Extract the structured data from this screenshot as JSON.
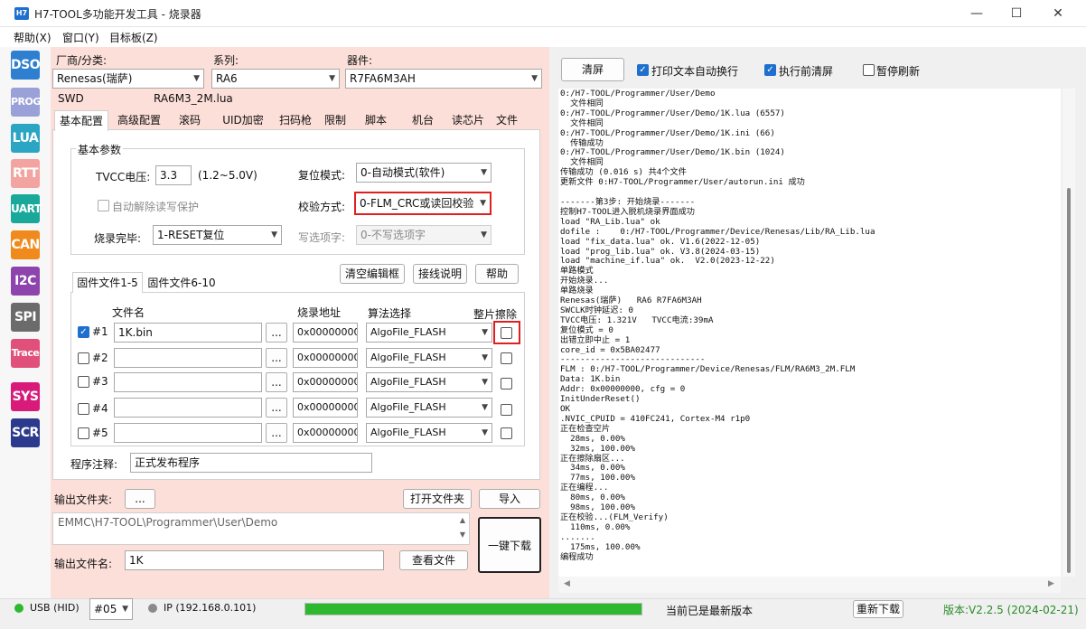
{
  "window": {
    "title": "H7-TOOL多功能开发工具 - 烧录器",
    "icon_text": "H7",
    "minimize": "—",
    "maximize": "☐",
    "close": "✕"
  },
  "menu": [
    "帮助(X)",
    "窗口(Y)",
    "目标板(Z)"
  ],
  "sidebar": [
    {
      "label": "DSO",
      "color": "#2f7fd0"
    },
    {
      "label": "PROG",
      "color": "#9aa0d8"
    },
    {
      "label": "LUA",
      "color": "#2aa6c4"
    },
    {
      "label": "RTT",
      "color": "#f2a4a0"
    },
    {
      "label": "UART",
      "color": "#1aa89a"
    },
    {
      "label": "CAN",
      "color": "#f08a1c"
    },
    {
      "label": "I2C",
      "color": "#8e44ad"
    },
    {
      "label": "SPI",
      "color": "#6b6b6b"
    },
    {
      "label": "Trace",
      "color": "#e0507a"
    },
    {
      "label": "SYS",
      "color": "#d81b7a"
    },
    {
      "label": "SCR",
      "color": "#2b3a8c"
    }
  ],
  "vendor": {
    "label": "厂商/分类:",
    "value": "Renesas(瑞萨)"
  },
  "series": {
    "label": "系列:",
    "value": "RA6"
  },
  "device": {
    "label": "器件:",
    "value": "R7FA6M3AH"
  },
  "interface": "SWD",
  "lua_file": "RA6M3_2M.lua",
  "tabs": [
    "基本配置",
    "高级配置",
    "滚码",
    "UID加密",
    "扫码枪",
    "限制",
    "脚本",
    "机台",
    "读芯片",
    "文件"
  ],
  "basic": {
    "group_title": "基本参数",
    "tvcc_label": "TVCC电压:",
    "tvcc_value": "3.3",
    "tvcc_range": "(1.2~5.0V)",
    "reset_label": "复位模式:",
    "reset_value": "0-自动模式(软件)",
    "auto_unlock_label": "自动解除读写保护",
    "verify_label": "校验方式:",
    "verify_value": "0-FLM_CRC或读回校验",
    "after_label": "烧录完毕:",
    "after_value": "1-RESET复位",
    "option_label": "写选项字:",
    "option_value": "0-不写选项字"
  },
  "actions": {
    "clear": "清空编辑框",
    "wiring": "接线说明",
    "help": "帮助"
  },
  "file_tabs": [
    "固件文件1-5",
    "固件文件6-10"
  ],
  "file_table": {
    "headers": {
      "filename": "文件名",
      "address": "烧录地址",
      "algo": "算法选择",
      "erase": "整片擦除"
    },
    "browse_label": "...",
    "rows": [
      {
        "id": "#1",
        "checked": true,
        "file": "1K.bin",
        "address": "0x00000000",
        "algo": "AlgoFile_FLASH"
      },
      {
        "id": "#2",
        "checked": false,
        "file": "",
        "address": "0x00000000",
        "algo": "AlgoFile_FLASH"
      },
      {
        "id": "#3",
        "checked": false,
        "file": "",
        "address": "0x00000000",
        "algo": "AlgoFile_FLASH"
      },
      {
        "id": "#4",
        "checked": false,
        "file": "",
        "address": "0x00000000",
        "algo": "AlgoFile_FLASH"
      },
      {
        "id": "#5",
        "checked": false,
        "file": "",
        "address": "0x00000000",
        "algo": "AlgoFile_FLASH"
      }
    ]
  },
  "comment": {
    "label": "程序注释:",
    "value": "正式发布程序"
  },
  "output": {
    "folder_label": "输出文件夹:",
    "folder_btn": "...",
    "open_btn": "打开文件夹",
    "import_btn": "导入",
    "path": "EMMC\\H7-TOOL\\Programmer\\User\\Demo",
    "filename_label": "输出文件名:",
    "filename_value": "1K",
    "view_btn": "查看文件",
    "download_btn": "一键下载"
  },
  "log_panel": {
    "clear_btn": "清屏",
    "wrap_label": "打印文本自动换行",
    "clear_before_label": "执行前清屏",
    "pause_label": "暂停刷新",
    "lines": [
      "0:/H7-TOOL/Programmer/User/Demo",
      "  文件相同",
      "0:/H7-TOOL/Programmer/User/Demo/1K.lua (6557)",
      "  文件相同",
      "0:/H7-TOOL/Programmer/User/Demo/1K.ini (66)",
      "  传输成功",
      "0:/H7-TOOL/Programmer/User/Demo/1K.bin (1024)",
      "  文件相同",
      "传输成功 (0.016 s) 共4个文件",
      "更新文件 0:H7-TOOL/Programmer/User/autorun.ini 成功",
      "",
      "-------第3步: 开始烧录-------",
      "控制H7-TOOL进入脱机烧录界面成功",
      "load \"RA_Lib.lua\" ok",
      "dofile :    0:/H7-TOOL/Programmer/Device/Renesas/Lib/RA_Lib.lua",
      "load \"fix_data.lua\" ok. V1.6(2022-12-05)",
      "load \"prog_lib.lua\" ok. V3.8(2024-03-15)",
      "load \"machine_if.lua\" ok.  V2.0(2023-12-22)",
      "单路模式",
      "开始烧录...",
      "单路烧录",
      "Renesas(瑞萨)   RA6 R7FA6M3AH",
      "SWCLK时钟延迟: 0",
      "TVCC电压: 1.321V   TVCC电流:39mA",
      "复位模式 = 0",
      "出错立即中止 = 1",
      "core_id = 0x5BA02477",
      "-----------------------------",
      "FLM : 0:/H7-TOOL/Programmer/Device/Renesas/FLM/RA6M3_2M.FLM",
      "Data: 1K.bin",
      "Addr: 0x00000000, cfg = 0",
      "InitUnderReset()",
      "OK",
      ".NVIC_CPUID = 410FC241, Cortex-M4 r1p0",
      "正在检查空片",
      "  28ms, 0.00%",
      "  32ms, 100.00%",
      "正在擦除扇区...",
      "  34ms, 0.00%",
      "  77ms, 100.00%",
      "正在编程...",
      "  80ms, 0.00%",
      "  98ms, 100.00%",
      "正在校验...(FLM_Verify)",
      "  110ms, 0.00%",
      ".......",
      "  175ms, 100.00%",
      "编程成功"
    ]
  },
  "status": {
    "usb": "USB (HID)",
    "port": "#05",
    "ip": "IP (192.168.0.101)",
    "progress": 1.0,
    "update_text": "当前已是最新版本",
    "redownload_btn": "重新下载",
    "version": "版本:V2.2.5 (2024-02-21)",
    "accent_green": "#2eb82e",
    "highlight_red": "#e02020"
  }
}
